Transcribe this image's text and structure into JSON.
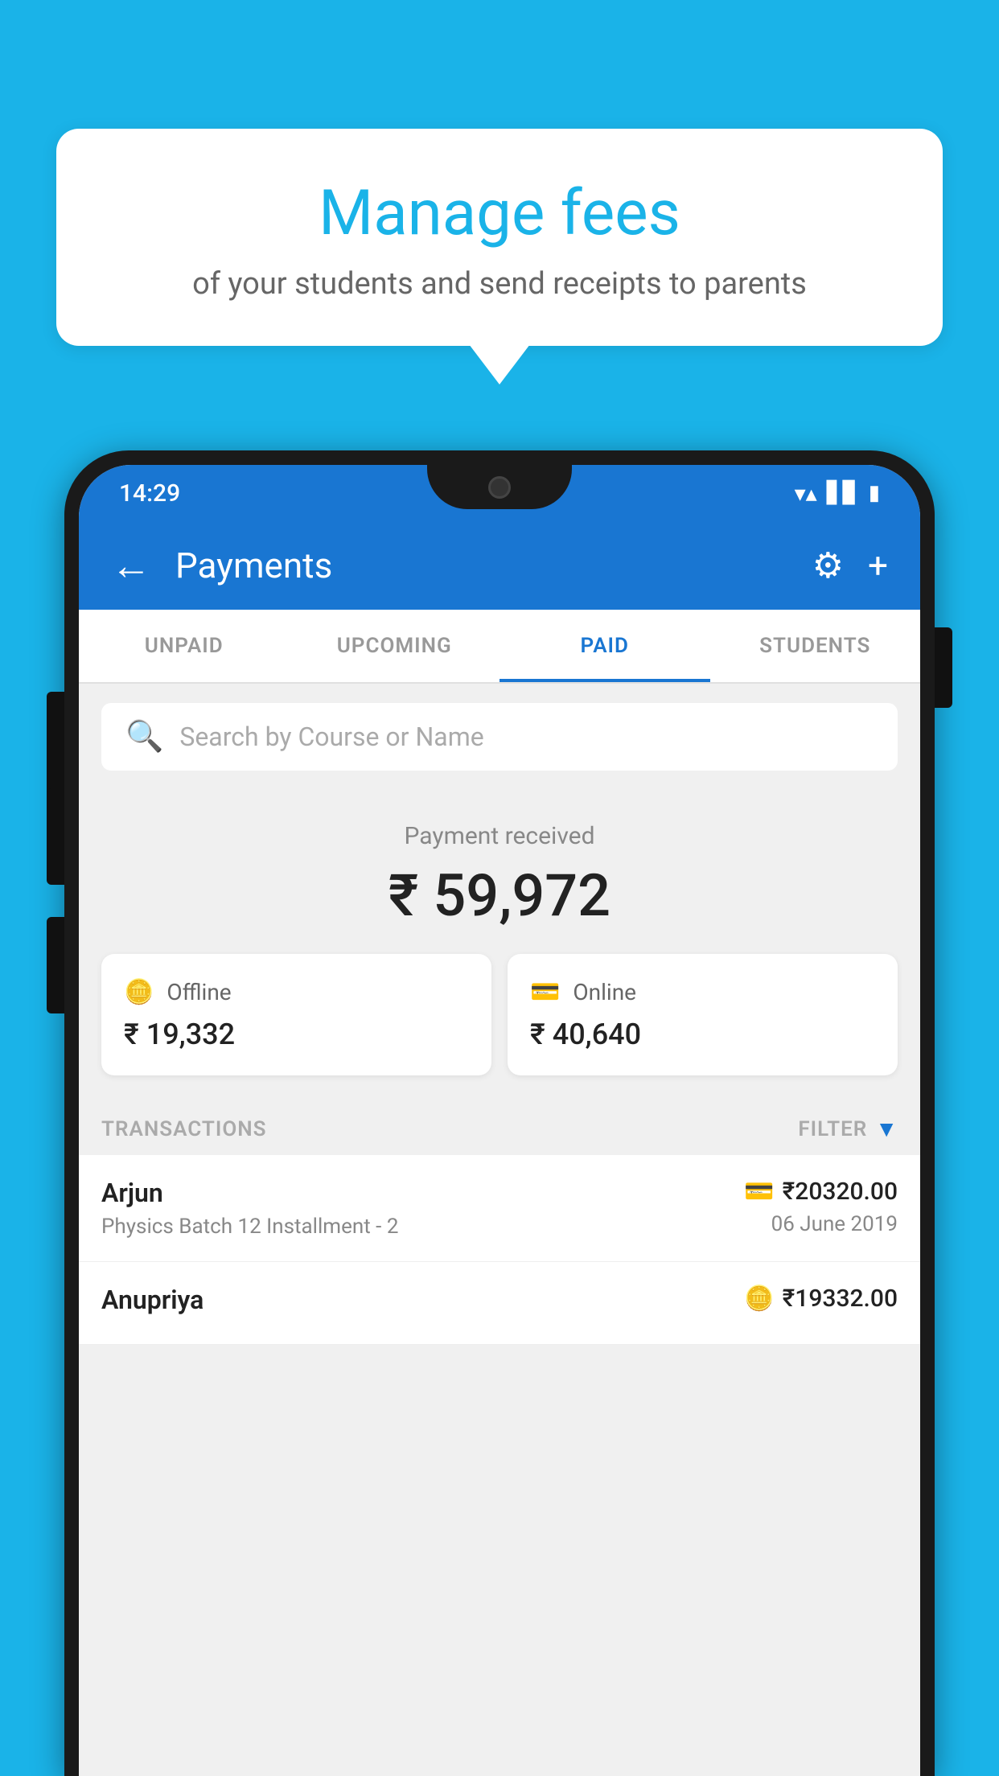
{
  "background_color": "#1ab3e8",
  "tooltip": {
    "title": "Manage fees",
    "subtitle": "of your students and send receipts to parents"
  },
  "phone": {
    "status_bar": {
      "time": "14:29",
      "icons": [
        "wifi",
        "signal",
        "battery"
      ]
    },
    "app_bar": {
      "back_label": "←",
      "title": "Payments",
      "gear_label": "⚙",
      "plus_label": "+"
    },
    "tabs": [
      {
        "label": "UNPAID",
        "active": false
      },
      {
        "label": "UPCOMING",
        "active": false
      },
      {
        "label": "PAID",
        "active": true
      },
      {
        "label": "STUDENTS",
        "active": false
      }
    ],
    "search": {
      "placeholder": "Search by Course or Name"
    },
    "payment_summary": {
      "label": "Payment received",
      "amount": "₹ 59,972",
      "offline_label": "Offline",
      "offline_amount": "₹ 19,332",
      "online_label": "Online",
      "online_amount": "₹ 40,640"
    },
    "transactions_section": {
      "label": "TRANSACTIONS",
      "filter_label": "FILTER"
    },
    "transactions": [
      {
        "name": "Arjun",
        "detail": "Physics Batch 12 Installment - 2",
        "amount": "₹20320.00",
        "date": "06 June 2019",
        "payment_type": "online"
      },
      {
        "name": "Anupriya",
        "detail": "",
        "amount": "₹19332.00",
        "date": "",
        "payment_type": "offline"
      }
    ]
  }
}
